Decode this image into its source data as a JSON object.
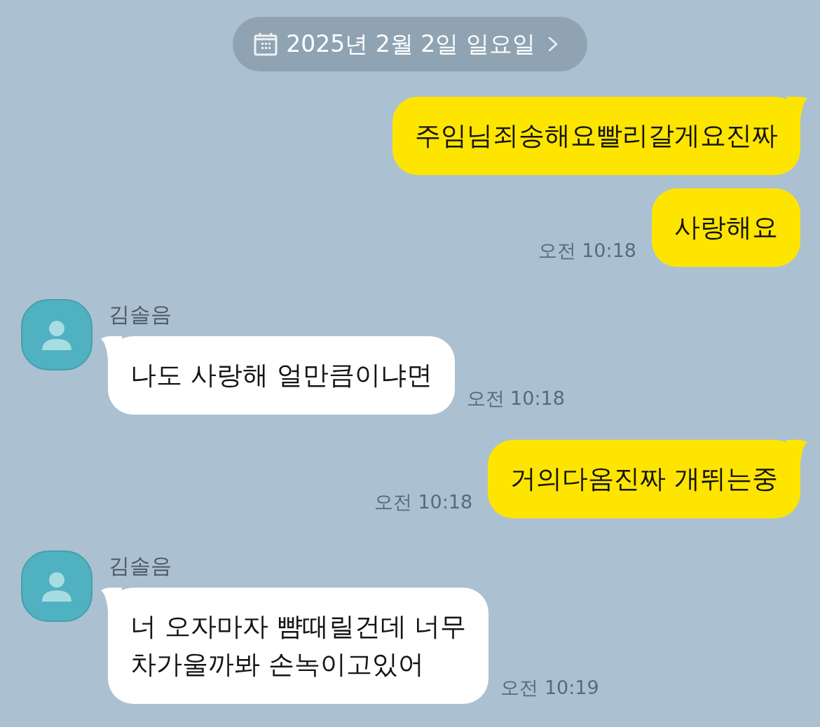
{
  "date_header": {
    "label": "2025년 2월 2일 일요일"
  },
  "messages": [
    {
      "kind": "sent",
      "text": "주임님죄송해요빨리갈게요진짜",
      "tail": true
    },
    {
      "kind": "sent",
      "text": "사랑해요",
      "tail": false,
      "time": "오전 10:18"
    },
    {
      "kind": "received",
      "sender": "김솔음",
      "text": "나도 사랑해 얼만큼이냐면",
      "tail": true,
      "time": "오전 10:18"
    },
    {
      "kind": "sent",
      "text": "거의다옴진짜 개뛰는중",
      "tail": true,
      "time": "오전 10:18"
    },
    {
      "kind": "received",
      "sender": "김솔음",
      "text": "너 오자마자 뺨때릴건데 너무\n차가울까봐 손녹이고있어",
      "tail": true,
      "time": "오전 10:19"
    }
  ]
}
